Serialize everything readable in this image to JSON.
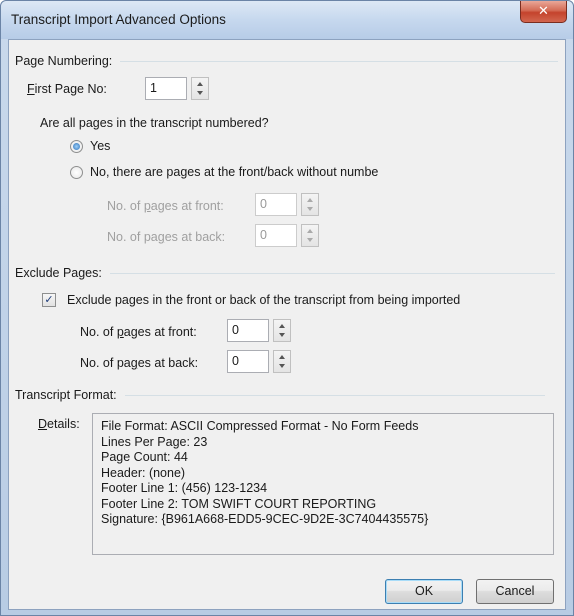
{
  "window": {
    "title": "Transcript Import Advanced Options",
    "close_label": "✕"
  },
  "page_numbering": {
    "heading": "Page Numbering:",
    "first_page_label_u": "F",
    "first_page_label_rest": "irst Page No:",
    "first_page_value": "1",
    "question": "Are all pages in the transcript numbered?",
    "yes_label": "Yes",
    "no_label": "No, there are pages at the front/back without numbe",
    "selected": "yes",
    "front_label_a": "No. of ",
    "front_label_u": "p",
    "front_label_b": "ages at front:",
    "front_value": "0",
    "back_label_a": "No. of pa",
    "back_label_u": "g",
    "back_label_b": "es at back:",
    "back_value": "0"
  },
  "exclude_pages": {
    "heading": "Exclude Pages:",
    "checkbox_label": "Exclude pages in the front or back of the transcript from being imported",
    "checked": true,
    "front_label_a": "No. of ",
    "front_label_u": "p",
    "front_label_b": "ages at front:",
    "front_value": "0",
    "back_label_a": "No. of pa",
    "back_label_u": "g",
    "back_label_b": "es at back:",
    "back_value": "0"
  },
  "transcript_format": {
    "heading": "Transcript Format:",
    "details_label_u": "D",
    "details_label_rest": "etails:",
    "details_lines": [
      "File Format:  ASCII Compressed Format - No Form Feeds",
      "Lines Per Page:  23",
      "Page Count:  44",
      "Header:  (none)",
      "Footer Line 1:  (456) 123-1234",
      "Footer Line 2:  TOM SWIFT COURT REPORTING",
      "Signature:  {B961A668-EDD5-9CEC-9D2E-3C7404435575}"
    ]
  },
  "buttons": {
    "ok": "OK",
    "cancel": "Cancel"
  },
  "colors": {
    "title_bar": "#c6d8ee",
    "close_button": "#c4432c",
    "dialog_bg": "#f0f0f0",
    "radio_dot": "#2a6fb8"
  }
}
